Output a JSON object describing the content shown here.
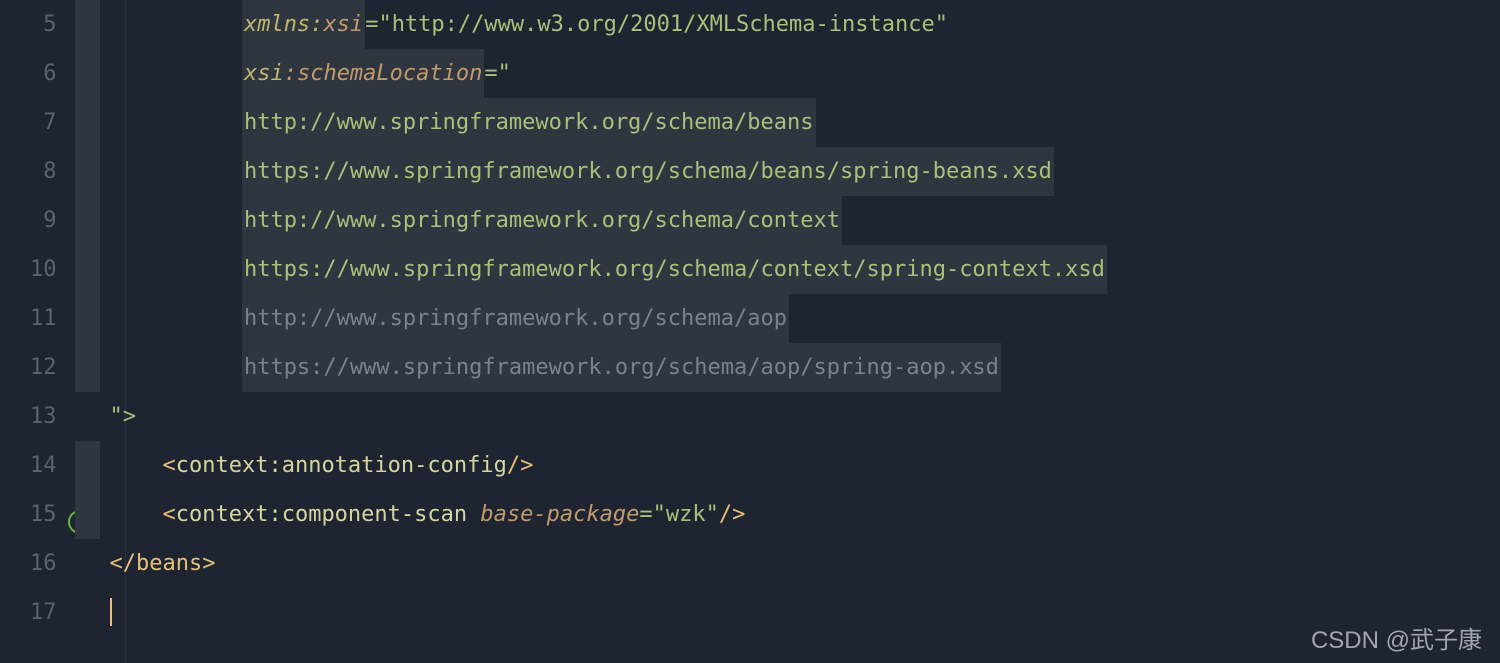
{
  "gutter": {
    "lines": [
      "5",
      "6",
      "7",
      "8",
      "9",
      "10",
      "11",
      "12",
      "13",
      "14",
      "15",
      "16",
      "17"
    ],
    "iconLine": 15
  },
  "code": {
    "line5": {
      "ns": "xmlns:",
      "prefix": "xsi",
      "eq": "=",
      "quote": "\"",
      "url": "http://www.w3.org/2001/XMLSchema-instance",
      "endquote": "\""
    },
    "line6": {
      "prefix": "xsi",
      "colon": ":",
      "attr": "schemaLocation",
      "eq": "=",
      "quote": "\""
    },
    "line7": {
      "url": "http://www.springframework.org/schema/beans"
    },
    "line8": {
      "url": "https://www.springframework.org/schema/beans/spring-beans.xsd"
    },
    "line9": {
      "url": "http://www.springframework.org/schema/context"
    },
    "line10": {
      "url": "https://www.springframework.org/schema/context/spring-context.xsd"
    },
    "line11": {
      "url": "http://www.springframework.org/schema/aop"
    },
    "line12": {
      "url": "https://www.springframework.org/schema/aop/spring-aop.xsd"
    },
    "line13": {
      "close": "\">"
    },
    "line14": {
      "open": "<",
      "ns": "context",
      "colon": ":",
      "tag": "annotation-config",
      "close": "/>"
    },
    "line15": {
      "open": "<",
      "ns": "context",
      "colon": ":",
      "tag": "component-scan",
      "space": " ",
      "attr": "base-package",
      "eq": "=",
      "quote": "\"",
      "value": "wzk",
      "endquote": "\"",
      "close": "/>"
    },
    "line16": {
      "open": "</",
      "tag": "beans",
      "close": ">"
    }
  },
  "watermark": "CSDN @武子康"
}
